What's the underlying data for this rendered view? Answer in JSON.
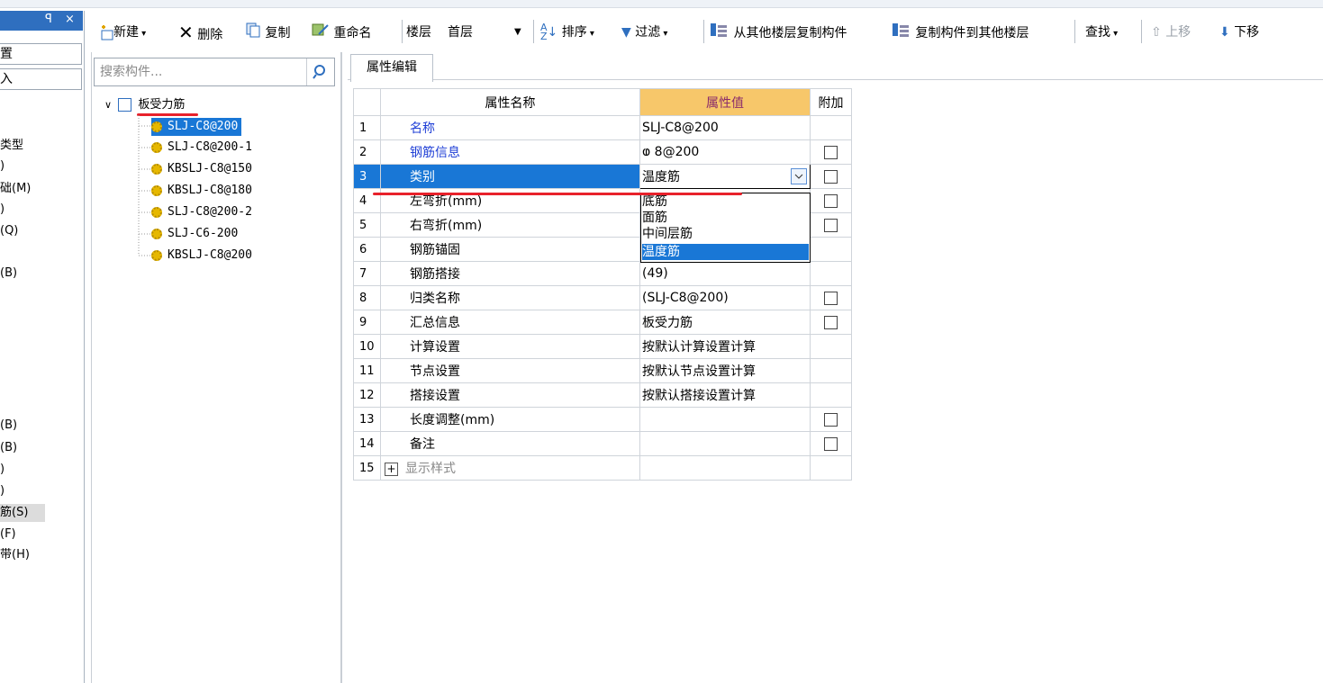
{
  "toolbar": {
    "new_label": "新建",
    "delete_label": "删除",
    "copy_label": "复制",
    "rename_label": "重命名",
    "floor_label": "楼层",
    "floor_value": "首层",
    "sort_label": "排序",
    "filter_label": "过滤",
    "copy_from_floor_label": "从其他楼层复制构件",
    "copy_to_floor_label": "复制构件到其他楼层",
    "find_label": "查找",
    "move_up_label": "上移",
    "move_down_label": "下移"
  },
  "nav": {
    "pin_label": "ꟼ",
    "close_label": "×",
    "button1": "置",
    "button2": "入",
    "items": [
      {
        "label": "类型",
        "top": 0
      },
      {
        "label": ")"
      },
      {
        "label": "础(M)"
      },
      {
        "label": ")"
      },
      {
        "label": "(Q)"
      },
      {
        "label": "(B)"
      },
      {
        "label": "(B)"
      },
      {
        "label": "(B)"
      },
      {
        "label": ")"
      },
      {
        "label": ")"
      },
      {
        "label": "筋(S)"
      },
      {
        "label": "(F)"
      },
      {
        "label": "带(H)"
      }
    ]
  },
  "tree": {
    "search_placeholder": "搜索构件...",
    "root_label": "板受力筋",
    "children": [
      "SLJ-C8@200",
      "SLJ-C8@200-1",
      "KBSLJ-C8@150",
      "KBSLJ-C8@180",
      "SLJ-C8@200-2",
      "SLJ-C6-200",
      "KBSLJ-C8@200"
    ]
  },
  "props": {
    "tab_label": "属性编辑",
    "headers": {
      "name": "属性名称",
      "value": "属性值",
      "extra": "附加"
    },
    "rows": [
      {
        "num": "1",
        "name": "名称",
        "value": "SLJ-C8@200"
      },
      {
        "num": "2",
        "name": "钢筋信息",
        "value": "ⱷ 8@200"
      },
      {
        "num": "3",
        "name": "类别",
        "value": "温度筋"
      },
      {
        "num": "4",
        "name": "左弯折(mm)",
        "value": ""
      },
      {
        "num": "5",
        "name": "右弯折(mm)",
        "value": ""
      },
      {
        "num": "6",
        "name": "钢筋锚固",
        "value": ""
      },
      {
        "num": "7",
        "name": "钢筋搭接",
        "value": "(49)"
      },
      {
        "num": "8",
        "name": "归类名称",
        "value": "(SLJ-C8@200)"
      },
      {
        "num": "9",
        "name": "汇总信息",
        "value": "板受力筋"
      },
      {
        "num": "10",
        "name": "计算设置",
        "value": "按默认计算设置计算"
      },
      {
        "num": "11",
        "name": "节点设置",
        "value": "按默认节点设置计算"
      },
      {
        "num": "12",
        "name": "搭接设置",
        "value": "按默认搭接设置计算"
      },
      {
        "num": "13",
        "name": "长度调整(mm)",
        "value": ""
      },
      {
        "num": "14",
        "name": "备注",
        "value": ""
      },
      {
        "num": "15",
        "name": "显示样式",
        "value": ""
      }
    ],
    "dropdown_options": [
      "底筋",
      "面筋",
      "中间层筋",
      "温度筋"
    ]
  },
  "colors": {
    "accent_blue": "#1977d6",
    "header_value_bg": "#f7c76a",
    "red_marker": "#e8212b"
  }
}
